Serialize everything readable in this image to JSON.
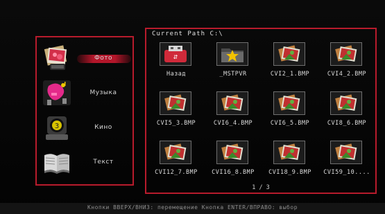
{
  "menu": {
    "items": [
      {
        "label": "Фото",
        "icon": "photo-icon",
        "active": true
      },
      {
        "label": "Музыка",
        "icon": "music-icon",
        "active": false
      },
      {
        "label": "Кино",
        "icon": "movie-icon",
        "active": false
      },
      {
        "label": "Текст",
        "icon": "book-icon",
        "active": false
      }
    ]
  },
  "browser": {
    "path_label": "Current Path C:\\",
    "files": [
      {
        "name": "Назад",
        "icon": "usb-back-icon"
      },
      {
        "name": "_MSTPVR",
        "icon": "folder-star-icon"
      },
      {
        "name": "CVI2_1.BMP",
        "icon": "image-file-icon"
      },
      {
        "name": "CVI4_2.BMP",
        "icon": "image-file-icon"
      },
      {
        "name": "CVI5_3.BMP",
        "icon": "image-file-icon"
      },
      {
        "name": "CVI6_4.BMP",
        "icon": "image-file-icon"
      },
      {
        "name": "CVI6_5.BMP",
        "icon": "image-file-icon"
      },
      {
        "name": "CVI8_6.BMP",
        "icon": "image-file-icon"
      },
      {
        "name": "CVI12_7.BMP",
        "icon": "image-file-icon"
      },
      {
        "name": "CVI16_8.BMP",
        "icon": "image-file-icon"
      },
      {
        "name": "CVI18_9.BMP",
        "icon": "image-file-icon"
      },
      {
        "name": "CVI59_10....",
        "icon": "image-file-icon"
      }
    ],
    "page_indicator": "1 / 3"
  },
  "footer": {
    "hint": "Кнопки ВВЕРХ/ВНИЗ: перемещение   Кнопка ENTER/ВПРАВО: выбор"
  },
  "colors": {
    "accent": "#b81b2c",
    "background": "#060606"
  }
}
